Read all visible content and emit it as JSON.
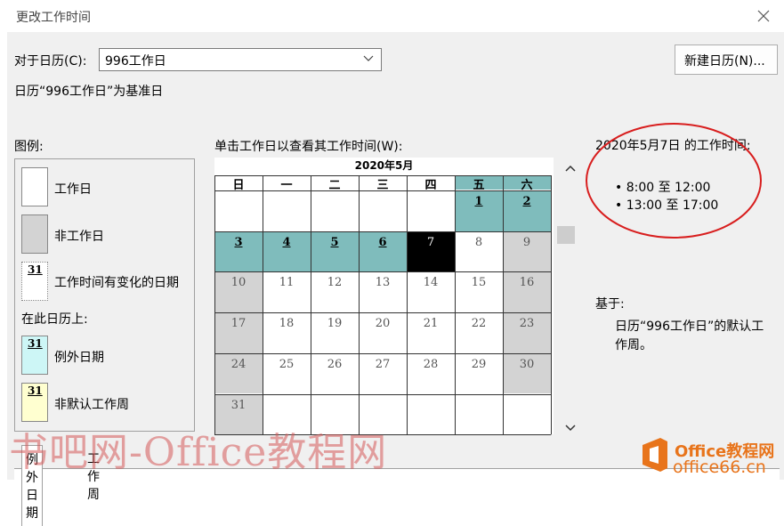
{
  "window": {
    "title": "更改工作时间"
  },
  "calendar_select": {
    "label": "对于日历(C):",
    "value": "996工作日"
  },
  "base_info": "日历“996工作日”为基准日",
  "new_calendar_button": "新建日历(N)...",
  "legend": {
    "header": "图例:",
    "working": "工作日",
    "nonworking": "非工作日",
    "changed": "工作时间有变化的日期",
    "sample_day": "31",
    "on_this_calendar": "在此日历上:",
    "exception": "例外日期",
    "nondefault_week": "非默认工作周",
    "colors": {
      "working": "#ffffff",
      "nonworking": "#d3d3d3",
      "exception": "#cdf6f6",
      "nondefault": "#ffffd0"
    }
  },
  "calendar": {
    "prompt": "单击工作日以查看其工作时间(W):",
    "month_title": "2020年5月",
    "weekdays": [
      "日",
      "一",
      "二",
      "三",
      "四",
      "五",
      "六"
    ],
    "weeks": [
      [
        {
          "d": "",
          "t": "w"
        },
        {
          "d": "",
          "t": "w"
        },
        {
          "d": "",
          "t": "w"
        },
        {
          "d": "",
          "t": "w"
        },
        {
          "d": "",
          "t": "w"
        },
        {
          "d": "1",
          "t": "e"
        },
        {
          "d": "2",
          "t": "e"
        }
      ],
      [
        {
          "d": "3",
          "t": "e"
        },
        {
          "d": "4",
          "t": "e"
        },
        {
          "d": "5",
          "t": "e"
        },
        {
          "d": "6",
          "t": "e"
        },
        {
          "d": "7",
          "t": "s"
        },
        {
          "d": "8",
          "t": "w"
        },
        {
          "d": "9",
          "t": "n"
        }
      ],
      [
        {
          "d": "10",
          "t": "n"
        },
        {
          "d": "11",
          "t": "w"
        },
        {
          "d": "12",
          "t": "w"
        },
        {
          "d": "13",
          "t": "w"
        },
        {
          "d": "14",
          "t": "w"
        },
        {
          "d": "15",
          "t": "w"
        },
        {
          "d": "16",
          "t": "n"
        }
      ],
      [
        {
          "d": "17",
          "t": "n"
        },
        {
          "d": "18",
          "t": "w"
        },
        {
          "d": "19",
          "t": "w"
        },
        {
          "d": "20",
          "t": "w"
        },
        {
          "d": "21",
          "t": "w"
        },
        {
          "d": "22",
          "t": "w"
        },
        {
          "d": "23",
          "t": "n"
        }
      ],
      [
        {
          "d": "24",
          "t": "n"
        },
        {
          "d": "25",
          "t": "w"
        },
        {
          "d": "26",
          "t": "w"
        },
        {
          "d": "27",
          "t": "w"
        },
        {
          "d": "28",
          "t": "w"
        },
        {
          "d": "29",
          "t": "w"
        },
        {
          "d": "30",
          "t": "n"
        }
      ],
      [
        {
          "d": "31",
          "t": "n"
        },
        {
          "d": "",
          "t": "w"
        },
        {
          "d": "",
          "t": "w"
        },
        {
          "d": "",
          "t": "w"
        },
        {
          "d": "",
          "t": "w"
        },
        {
          "d": "",
          "t": "w"
        },
        {
          "d": "",
          "t": "w"
        }
      ]
    ],
    "colors": {
      "exception": "#7fbcbc",
      "selected": "#000000",
      "nonworking": "#d3d3d3",
      "working": "#ffffff"
    }
  },
  "info": {
    "heading": "2020年5月7日 的工作时间:",
    "times": [
      "• 8:00 至 12:00",
      "• 13:00 至 17:00"
    ],
    "based_on_label": "基于:",
    "based_on_line1": "日历“996工作日”的默认工",
    "based_on_line2": "作周。"
  },
  "tabs": [
    {
      "label": "例外日期",
      "active": true
    },
    {
      "label": "工作周",
      "active": false
    }
  ],
  "watermark": "书吧网-Office教程网",
  "logo": {
    "line1": "Office教程网",
    "line2": "office66.cn",
    "color": "#e8741b"
  },
  "annotation_color": "#d81e1e"
}
